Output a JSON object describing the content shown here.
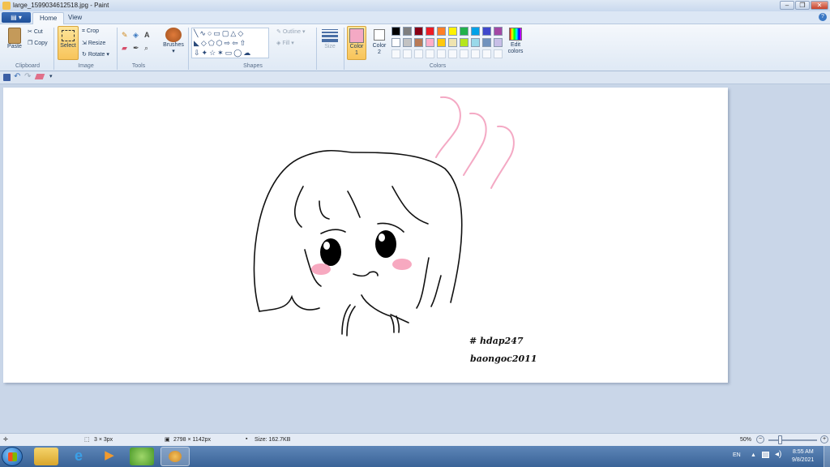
{
  "window": {
    "title": "large_1599034612518.jpg - Paint",
    "buttons": [
      "minimize",
      "maximize",
      "close"
    ]
  },
  "tabs": {
    "file": "",
    "home": "Home",
    "view": "View"
  },
  "ribbon": {
    "clipboard": {
      "label": "Clipboard",
      "paste": "Paste",
      "cut": "Cut",
      "copy": "Copy"
    },
    "image": {
      "label": "Image",
      "select": "Select",
      "crop": "Crop",
      "resize": "Resize",
      "rotate": "Rotate"
    },
    "tools": {
      "label": "Tools"
    },
    "brushes": {
      "label": "Brushes"
    },
    "shapes": {
      "label": "Shapes",
      "outline": "Outline",
      "fill": "Fill"
    },
    "size": {
      "label": "Size"
    },
    "colors": {
      "label": "Colors",
      "color1": "Color 1",
      "color2": "Color 2",
      "edit": "Edit colors",
      "color1_value": "#f4a9c4",
      "color2_value": "#ffffff",
      "palette_row1": [
        "#000000",
        "#7f7f7f",
        "#880015",
        "#ed1c24",
        "#ff7f27",
        "#fff200",
        "#22b14c",
        "#00a2e8",
        "#3f48cc",
        "#a349a4"
      ],
      "palette_row2": [
        "#ffffff",
        "#c3c3c3",
        "#b97a57",
        "#ffaec9",
        "#ffc90e",
        "#efe4b0",
        "#b5e61d",
        "#99d9ea",
        "#7092be",
        "#c8bfe7"
      ]
    }
  },
  "canvas": {
    "signature_line1": "# hdap247",
    "signature_line2": "baongoc2011"
  },
  "status": {
    "cursor": "3 × 3px",
    "dimensions": "2798 × 1142px",
    "size": "Size: 162.7KB",
    "zoom": "50%"
  },
  "taskbar": {
    "lang": "EN",
    "time": "8:55 AM",
    "date": "9/8/2021"
  }
}
